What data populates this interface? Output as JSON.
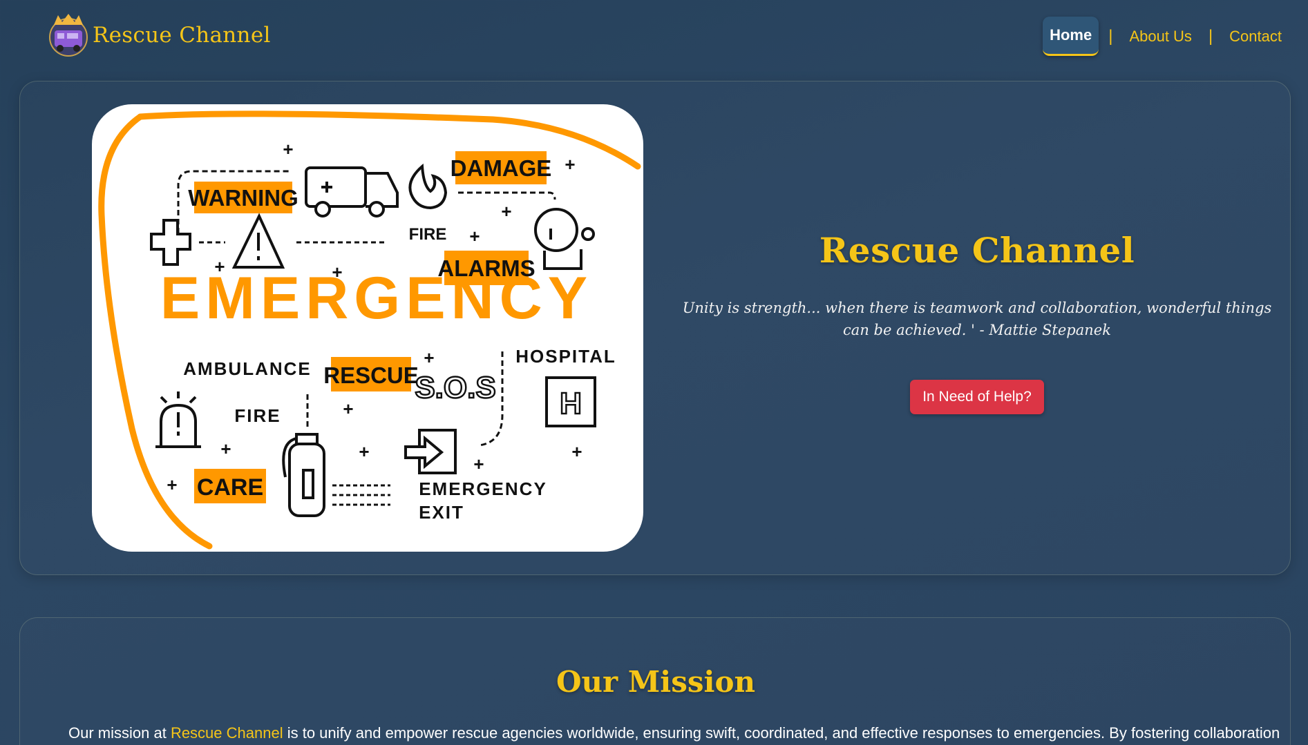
{
  "brand": {
    "name": "Rescue Channel",
    "logo_icon": "rescue-truck-logo-icon"
  },
  "nav": {
    "items": [
      {
        "label": "Home",
        "active": true
      },
      {
        "label": "About Us",
        "active": false
      },
      {
        "label": "Contact",
        "active": false
      }
    ],
    "separator": "|"
  },
  "hero": {
    "title": "Rescue Channel",
    "quote": "Unity is strength... when there is teamwork and collaboration, wonderful things can be achieved. ' - Mattie Stepanek",
    "help_button": "In Need of Help?",
    "image": {
      "words": {
        "warning": "WARNING",
        "damage": "DAMAGE",
        "fire1": "FIRE",
        "alarms": "ALARMS",
        "emergency": "EMERGENCY",
        "ambulance": "AMBULANCE",
        "rescue": "RESCUE",
        "sos": "S.O.S",
        "hospital": "HOSPITAL",
        "fire2": "FIRE",
        "care": "CARE",
        "exit1": "EMERGENCY",
        "exit2": "EXIT",
        "h": "H",
        "plus": "+"
      }
    }
  },
  "mission": {
    "title": "Our Mission",
    "text_before": "Our mission at ",
    "text_highlight": "Rescue Channel",
    "text_after": " is to unify and empower rescue agencies worldwide, ensuring swift, coordinated, and effective responses to emergencies. By fostering collaboration"
  },
  "colors": {
    "accent": "#f5c518",
    "background": "#2a4560",
    "danger": "#dc3545",
    "orange": "#ff9800"
  }
}
